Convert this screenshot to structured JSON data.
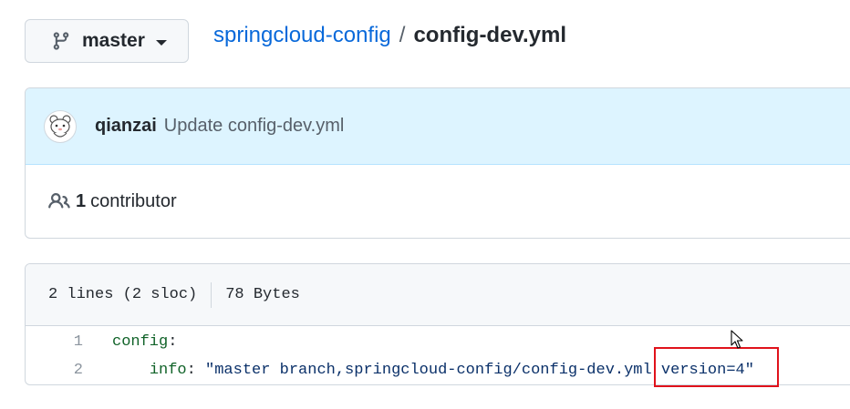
{
  "branch": {
    "label": "master",
    "icon": "git-branch-icon"
  },
  "breadcrumb": {
    "repo": "springcloud-config",
    "separator": "/",
    "file": "config-dev.yml"
  },
  "commit": {
    "author": "qianzai",
    "message": "Update config-dev.yml"
  },
  "contributors": {
    "count": "1",
    "label": "contributor"
  },
  "file_info": {
    "lines": "2 lines (2 sloc)",
    "size": "78 Bytes"
  },
  "code": {
    "line1": {
      "num": "1",
      "key": "config",
      "colon": ":"
    },
    "line2": {
      "num": "2",
      "indent": "    ",
      "key": "info",
      "colon": ": ",
      "value": "\"master branch,springcloud-config/config-dev.yml version=4\""
    }
  },
  "colors": {
    "link": "#0969da",
    "highlight": "#e0121b",
    "commit_bg": "#ddf4ff",
    "yaml_key": "#116329",
    "yaml_string": "#0a3069"
  }
}
